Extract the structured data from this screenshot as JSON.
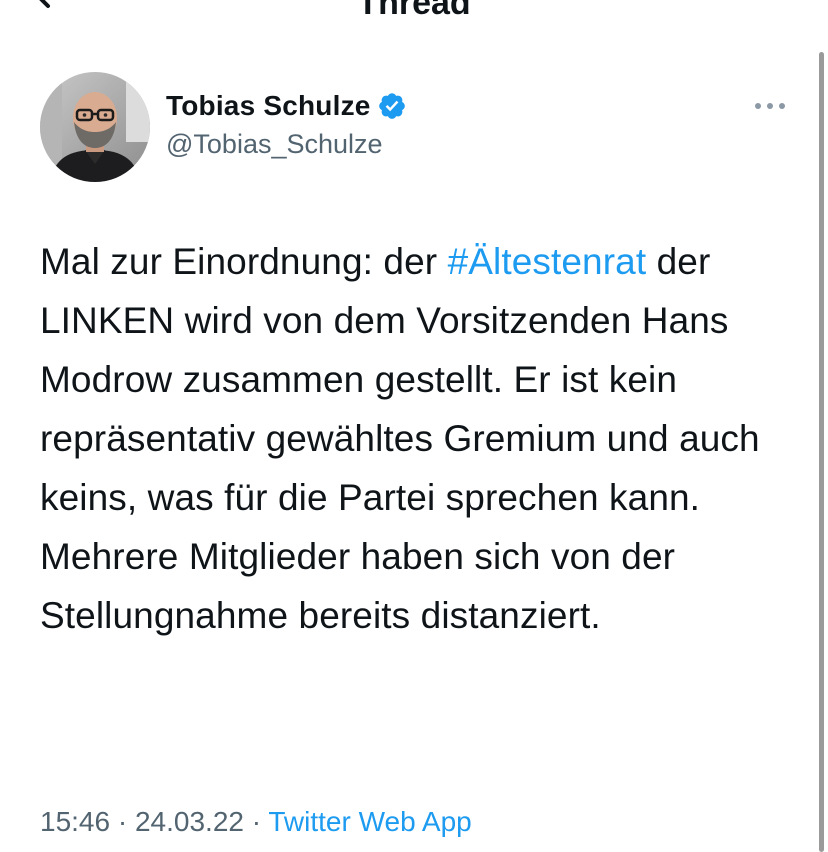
{
  "header": {
    "title": "Thread"
  },
  "tweet": {
    "author_name": "Tobias Schulze",
    "author_handle": "@Tobias_Schulze",
    "verified": true,
    "text_before_hashtag": "Mal zur Einordnung: der ",
    "hashtag": "#Ältestenrat",
    "text_after_hashtag": " der LINKEN wird von dem Vorsitzenden Hans Modrow zusammen gestellt. Er ist kein repräsentativ gewähltes Gremium und auch keins, was für die Partei sprechen kann. Mehrere Mitglieder haben sich von der Stellungnahme bereits distanziert.",
    "time": "15:46",
    "separator": "·",
    "date": "24.03.22",
    "source": "Twitter Web App"
  },
  "colors": {
    "accent": "#1d9bf0",
    "secondary_text": "#536471",
    "primary_text": "#0f1419"
  },
  "icons": {
    "back": "arrow-left-icon",
    "verified": "verified-badge-icon",
    "more": "more-horizontal-icon"
  }
}
